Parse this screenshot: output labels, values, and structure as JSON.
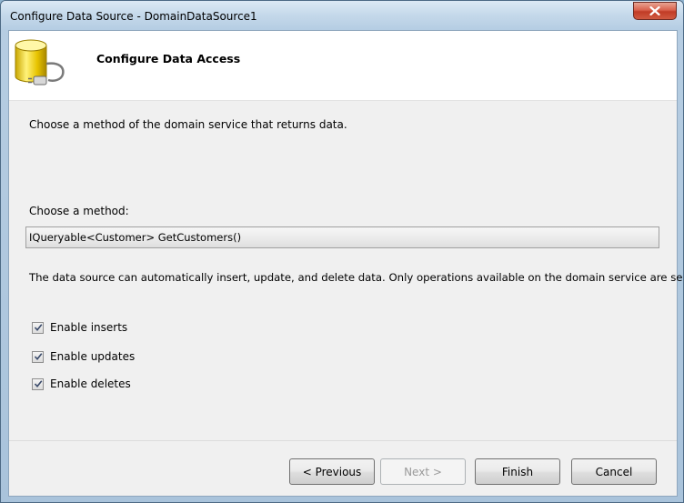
{
  "window": {
    "title": "Configure Data Source - DomainDataSource1"
  },
  "header": {
    "title": "Configure Data Access",
    "icon": "database-plug-icon"
  },
  "main": {
    "description": "Choose a method of the domain service that returns data.",
    "method_label": "Choose a method:",
    "method_selected": "IQueryable<Customer> GetCustomers()",
    "info": "The data source can automatically insert, update, and delete data. Only operations available on the domain service are selectable.",
    "options": [
      {
        "label": "Enable inserts",
        "checked": true
      },
      {
        "label": "Enable updates",
        "checked": true
      },
      {
        "label": "Enable deletes",
        "checked": true
      }
    ]
  },
  "footer": {
    "previous": "< Previous",
    "next": "Next >",
    "finish": "Finish",
    "cancel": "Cancel"
  },
  "colors": {
    "titlebar": "#c4d8ea",
    "close_button": "#c13c26",
    "client_bg": "#f0f0f0",
    "header_bg": "#ffffff"
  }
}
